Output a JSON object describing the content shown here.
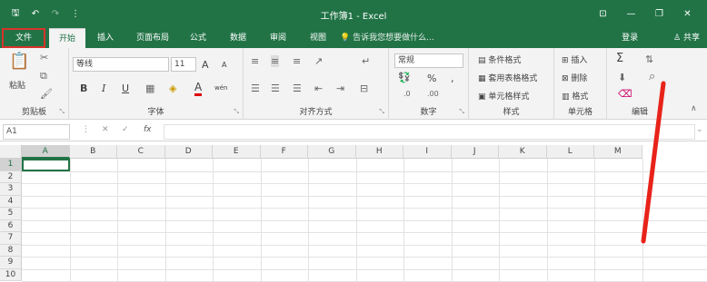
{
  "window": {
    "title": "工作簿1 - Excel",
    "qat": {
      "save": "🖫",
      "undo": "↶",
      "redo": "↷",
      "customize": "⋮"
    },
    "controls": {
      "ribbon_options": "⊡",
      "minimize": "—",
      "maximize": "❐",
      "close": "✕"
    }
  },
  "tabs": {
    "file": "文件",
    "home": "开始",
    "insert": "插入",
    "layout": "页面布局",
    "formulas": "公式",
    "data": "数据",
    "review": "审阅",
    "view": "视图"
  },
  "tell_me": "告诉我您想要做什么...",
  "account": {
    "login": "登录",
    "share": "共享"
  },
  "ribbon": {
    "clipboard": {
      "label": "剪贴板",
      "paste": "粘贴"
    },
    "font": {
      "label": "字体",
      "name": "等线",
      "size": "11",
      "bold": "B",
      "italic": "I",
      "underline": "U",
      "grow": "A",
      "shrink": "A",
      "color": "A",
      "wen": "wén"
    },
    "alignment": {
      "label": "对齐方式"
    },
    "number": {
      "label": "数字",
      "format": "常规",
      "percent": "%",
      "comma": ","
    },
    "styles": {
      "label": "样式",
      "conditional": "条件格式",
      "table": "套用表格格式",
      "cell": "单元格样式"
    },
    "cells": {
      "label": "单元格",
      "insert": "插入",
      "delete": "删除",
      "format": "格式"
    },
    "editing": {
      "label": "编辑",
      "sum": "Σ"
    }
  },
  "formula_bar": {
    "name_box": "A1",
    "cancel": "✕",
    "enter": "✓",
    "fx": "fx",
    "value": ""
  },
  "sheet": {
    "columns": [
      "A",
      "B",
      "C",
      "D",
      "E",
      "F",
      "G",
      "H",
      "I",
      "J",
      "K",
      "L",
      "M"
    ],
    "rows": [
      "1",
      "2",
      "3",
      "4",
      "5",
      "6",
      "7",
      "8",
      "9",
      "10"
    ],
    "selected_cell": "A1"
  },
  "colors": {
    "brand": "#217346",
    "highlight": "#d7332b",
    "annotation": "#e8231a"
  }
}
